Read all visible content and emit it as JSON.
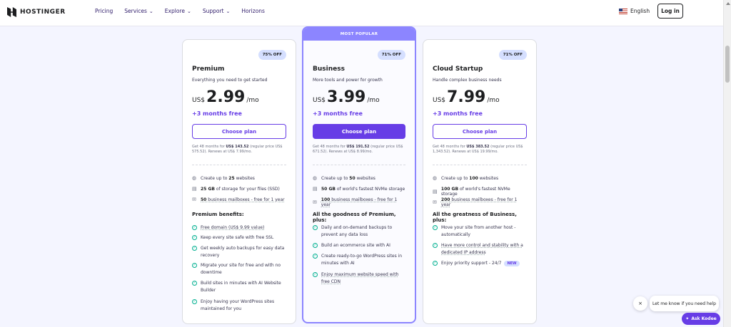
{
  "nav": {
    "brand": "HOSTINGER",
    "menu": [
      "Pricing",
      "Services",
      "Explore",
      "Support",
      "Horizons"
    ],
    "language": "English",
    "login": "Log in"
  },
  "plans": [
    {
      "badge": "75% OFF",
      "name": "Premium",
      "desc": "Everything you need to get started",
      "currency": "US$",
      "price": "2.99",
      "per": "/mo",
      "bonus": "+3 months free",
      "button": "Choose plan",
      "fine1": "Get 48 months for ",
      "fine_bold": "US$ 143.52",
      "fine2": " (regular price US$ 575.52). Renews at US$ 7.99/mo.",
      "features": [
        {
          "pre": "Create up to ",
          "bold": "25",
          "post": " websites",
          "icon": "globe-icon"
        },
        {
          "pre": "",
          "bold": "25 GB",
          "post": " of storage for your files (SSD)",
          "icon": "storage-icon"
        },
        {
          "pre": "",
          "bold": "50",
          "post": " business mailboxes - free for 1 year",
          "icon": "mail-icon"
        }
      ],
      "benefits_title": "Premium benefits:",
      "benefits": [
        "Free domain (US$ 9.99 value)",
        "Keep every site safe with free SSL",
        "Get weekly auto backups for easy data recovery",
        "Migrate your site for free and with no downtime",
        "Build sites in minutes with AI Website Builder",
        "Enjoy having your WordPress sites maintained for you"
      ]
    },
    {
      "popular": "MOST POPULAR",
      "badge": "71% OFF",
      "name": "Business",
      "desc": "More tools and power for growth",
      "currency": "US$",
      "price": "3.99",
      "per": "/mo",
      "bonus": "+3 months free",
      "button": "Choose plan",
      "fine1": "Get 48 months for ",
      "fine_bold": "US$ 191.52",
      "fine2": " (regular price US$ 671.52). Renews at US$ 8.99/mo.",
      "features": [
        {
          "pre": "Create up to ",
          "bold": "50",
          "post": " websites",
          "icon": "globe-icon"
        },
        {
          "pre": "",
          "bold": "50 GB",
          "post": " of world's fastest NVMe storage",
          "icon": "storage-icon"
        },
        {
          "pre": "",
          "bold": "100",
          "post": " business mailboxes - free for 1 year",
          "icon": "mail-icon"
        }
      ],
      "benefits_title": "All the goodness of Premium, plus:",
      "benefits": [
        "Daily and on-demand backups to prevent any data loss",
        "Build an ecommerce site with AI",
        "Create ready-to-go WordPress sites in minutes with AI",
        "Enjoy maximum website speed with free CDN"
      ]
    },
    {
      "badge": "71% OFF",
      "name": "Cloud Startup",
      "desc": "Handle complex business needs",
      "currency": "US$",
      "price": "7.99",
      "per": "/mo",
      "bonus": "+3 months free",
      "button": "Choose plan",
      "fine1": "Get 48 months for ",
      "fine_bold": "US$ 383.52",
      "fine2": " (regular price US$ 1,343.52). Renews at US$ 19.99/mo.",
      "features": [
        {
          "pre": "Create up to ",
          "bold": "100",
          "post": " websites",
          "icon": "globe-icon"
        },
        {
          "pre": "",
          "bold": "100 GB",
          "post": " of world's fastest NVMe storage",
          "icon": "storage-icon"
        },
        {
          "pre": "",
          "bold": "200",
          "post": " business mailboxes - free for 1 year",
          "icon": "mail-icon"
        }
      ],
      "benefits_title": "All the greatness of Business, plus:",
      "benefits": [
        "Move your site from another host - automatically",
        "Have more control and stability with a dedicated IP address",
        "Enjoy priority support - 24/7"
      ],
      "new_tag": "NEW"
    }
  ],
  "chat": {
    "bubble": "Let me know if you need help",
    "close": "×",
    "ask": "Ask Kodee"
  },
  "colors": {
    "accent": "#673de6",
    "popular": "#8c85ff",
    "check": "#00b090"
  }
}
